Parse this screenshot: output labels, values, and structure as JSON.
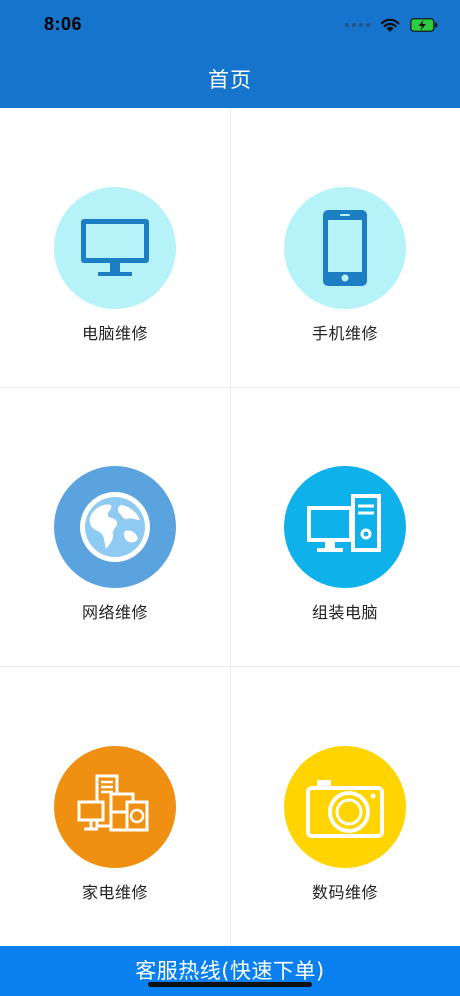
{
  "status_bar": {
    "time": "8:06",
    "icons": [
      "signal-icon",
      "wifi-icon",
      "battery-charging-icon"
    ]
  },
  "nav": {
    "title": "首页"
  },
  "services": [
    {
      "label": "电脑维修",
      "icon": "monitor-icon",
      "color": "#b5f3f8"
    },
    {
      "label": "手机维修",
      "icon": "smartphone-icon",
      "color": "#b5f3f8"
    },
    {
      "label": "网络维修",
      "icon": "globe-icon",
      "color": "#5ba3de"
    },
    {
      "label": "组装电脑",
      "icon": "desktop-computer-icon",
      "color": "#0fb1ea"
    },
    {
      "label": "家电维修",
      "icon": "appliances-icon",
      "color": "#f09012"
    },
    {
      "label": "数码维修",
      "icon": "camera-icon",
      "color": "#ffd400"
    }
  ],
  "footer": {
    "hotline_label": "客服热线(快速下单)"
  },
  "colors": {
    "header": "#1674cc",
    "footer_button": "#0a80f0"
  }
}
